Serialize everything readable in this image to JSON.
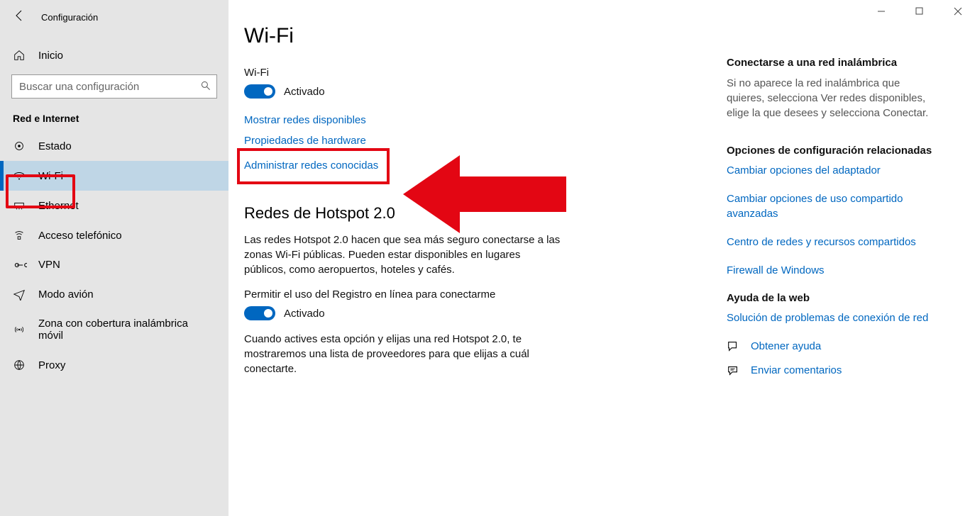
{
  "window": {
    "title": "Configuración",
    "search_placeholder": "Buscar una configuración"
  },
  "sidebar": {
    "home": "Inicio",
    "section": "Red e Internet",
    "items": [
      {
        "label": "Estado",
        "icon": "status-icon"
      },
      {
        "label": "Wi-Fi",
        "icon": "wifi-icon",
        "selected": true
      },
      {
        "label": "Ethernet",
        "icon": "ethernet-icon"
      },
      {
        "label": "Acceso telefónico",
        "icon": "dialup-icon"
      },
      {
        "label": "VPN",
        "icon": "vpn-icon"
      },
      {
        "label": "Modo avión",
        "icon": "airplane-icon"
      },
      {
        "label": "Zona con cobertura inalámbrica móvil",
        "icon": "hotspot-icon"
      },
      {
        "label": "Proxy",
        "icon": "proxy-icon"
      }
    ]
  },
  "main": {
    "title": "Wi-Fi",
    "wifi_label": "Wi-Fi",
    "toggle1": "Activado",
    "links": {
      "show": "Mostrar redes disponibles",
      "hardware": "Propiedades de hardware",
      "manage": "Administrar redes conocidas"
    },
    "hotspot": {
      "heading": "Redes de Hotspot 2.0",
      "desc": "Las redes Hotspot 2.0 hacen que sea más seguro conectarse a las zonas Wi-Fi públicas. Pueden estar disponibles en lugares públicos, como aeropuertos, hoteles y cafés.",
      "permit": "Permitir el uso del Registro en línea para conectarme",
      "toggle2": "Activado",
      "desc2": "Cuando actives esta opción y elijas una red Hotspot 2.0, te mostraremos una lista de proveedores para que elijas a cuál conectarte."
    }
  },
  "rail": {
    "connect_head": "Conectarse a una red inalámbrica",
    "connect_text": "Si no aparece la red inalámbrica que quieres, selecciona Ver redes disponibles, elige la que desees y selecciona Conectar.",
    "related_head": "Opciones de configuración relacionadas",
    "related_links": [
      "Cambiar opciones del adaptador",
      "Cambiar opciones de uso compartido avanzadas",
      "Centro de redes y recursos compartidos",
      "Firewall de Windows"
    ],
    "help_head": "Ayuda de la web",
    "help_link": "Solución de problemas de conexión de red",
    "get_help": "Obtener ayuda",
    "feedback": "Enviar comentarios"
  }
}
